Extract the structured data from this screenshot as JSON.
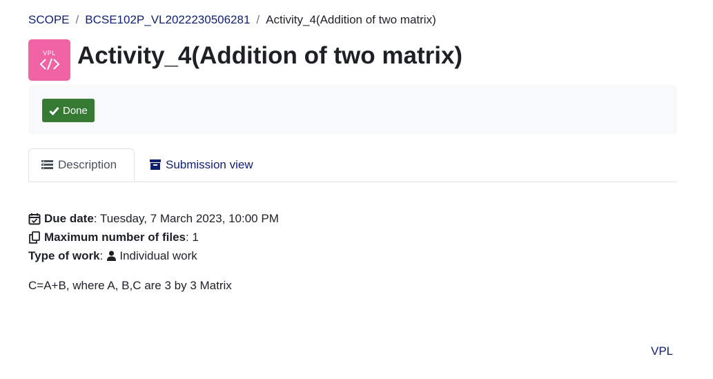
{
  "breadcrumb": {
    "items": [
      "SCOPE",
      "BCSE102P_VL2022230506281",
      "Activity_4(Addition of two matrix)"
    ],
    "separator": "/"
  },
  "activity": {
    "icon_label": "VPL",
    "icon_name": "code-icon",
    "icon_color": "#f064a6",
    "title": "Activity_4(Addition of two matrix)"
  },
  "completion": {
    "done_label": "Done",
    "done_color": "#357a32"
  },
  "tabs": [
    {
      "label": "Description",
      "icon": "list-icon",
      "active": true
    },
    {
      "label": "Submission view",
      "icon": "archive-icon",
      "active": false
    }
  ],
  "details": {
    "due_date_label": "Due date",
    "due_date_value": ": Tuesday, 7 March 2023, 10:00 PM",
    "max_files_label": "Maximum number of files",
    "max_files_value": ": 1",
    "work_type_label": "Type of work",
    "work_type_sep": ":",
    "work_type_value": "Individual work"
  },
  "description": "C=A+B, where A, B,C are 3 by 3 Matrix",
  "footer": {
    "link": "VPL"
  },
  "colors": {
    "link": "#0f1e6f",
    "text": "#1d2125"
  }
}
